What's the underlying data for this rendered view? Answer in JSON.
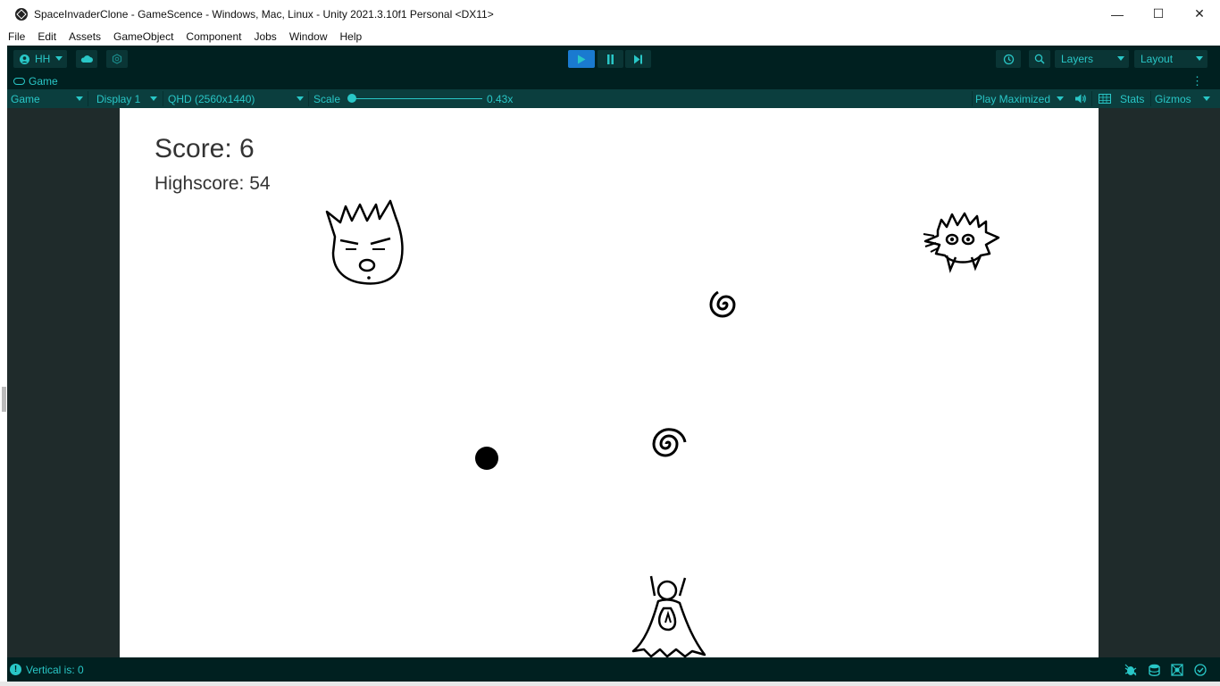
{
  "window": {
    "title": "SpaceInvaderClone - GameScence - Windows, Mac, Linux - Unity 2021.3.10f1 Personal <DX11>",
    "minimize": "—",
    "maximize": "☐",
    "close": "✕"
  },
  "menu": [
    "File",
    "Edit",
    "Assets",
    "GameObject",
    "Component",
    "Jobs",
    "Window",
    "Help"
  ],
  "toolbar": {
    "account": "HH",
    "layers": "Layers",
    "layout": "Layout"
  },
  "tab": {
    "label": "Game"
  },
  "game_options": {
    "view": "Game",
    "display": "Display 1",
    "resolution": "QHD (2560x1440)",
    "scale_label": "Scale",
    "scale_value": "0.43x",
    "scale_level": 0,
    "play_mode": "Play Maximized",
    "stats": "Stats",
    "gizmos": "Gizmos"
  },
  "game": {
    "score": "Score: 6",
    "highscore": "Highscore: 54"
  },
  "status": {
    "message": "Vertical is: 0"
  },
  "colors": {
    "accent": "#29c7c7",
    "toolbar_bg": "#002020",
    "options_bg": "#0b3e3e",
    "play_active": "#1a7ad0"
  }
}
